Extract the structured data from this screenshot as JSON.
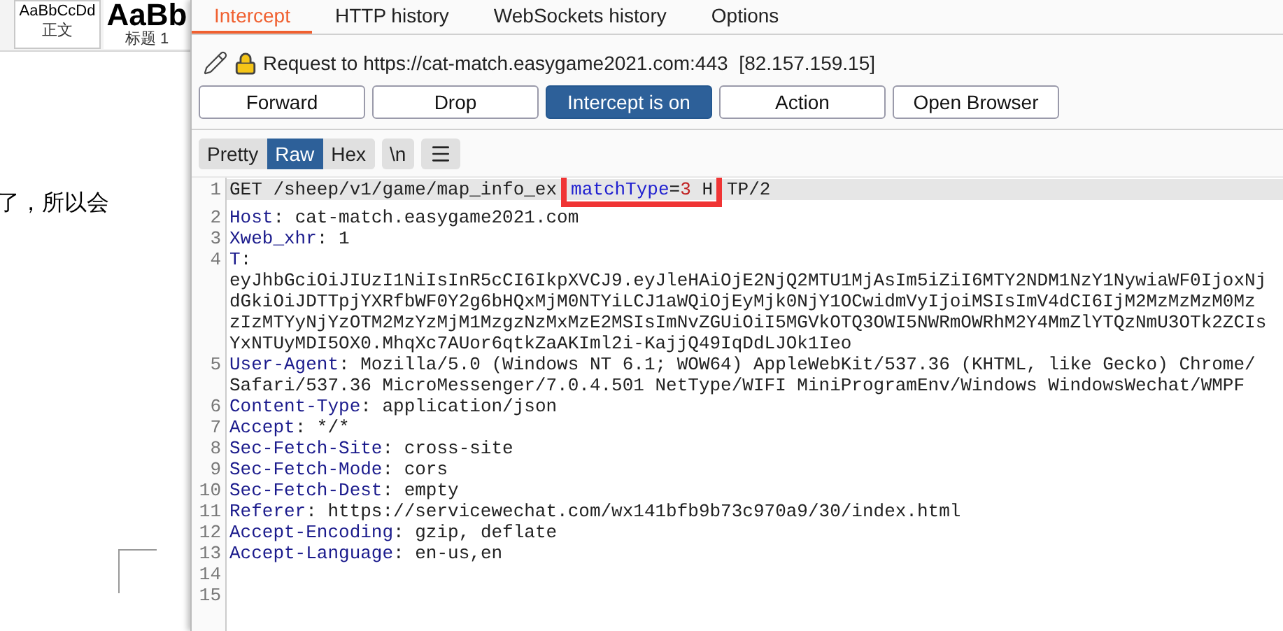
{
  "document": {
    "styles": [
      {
        "sample": "AaBbCcDd",
        "name": "正文",
        "selected": true
      },
      {
        "sample": "AaBb",
        "name": "标题 1",
        "selected": false
      }
    ],
    "text": "了，所以会"
  },
  "burp": {
    "tabs": [
      {
        "label": "Intercept",
        "selected": true
      },
      {
        "label": "HTTP history",
        "selected": false
      },
      {
        "label": "WebSockets history",
        "selected": false
      },
      {
        "label": "Options",
        "selected": false
      }
    ],
    "request_label": "Request to https://cat-match.easygame2021.com:443",
    "ip": "[82.157.159.15]",
    "buttons": [
      {
        "label": "Forward",
        "selected": false
      },
      {
        "label": "Drop",
        "selected": false
      },
      {
        "label": "Intercept is on",
        "selected": true
      },
      {
        "label": "Action",
        "selected": false
      },
      {
        "label": "Open Browser",
        "selected": false
      }
    ],
    "view_modes": [
      {
        "label": "Pretty",
        "selected": false
      },
      {
        "label": "Raw",
        "selected": true
      },
      {
        "label": "Hex",
        "selected": false
      }
    ],
    "newline_toggle": "\\n",
    "lines": [
      {
        "number": "1",
        "highlighted": true,
        "rows": [
          [
            {
              "kind": "plain",
              "text": "GET /sheep/v1/game/map_info_ex"
            },
            {
              "kind": "gap"
            },
            {
              "kind": "param",
              "text": "matchType"
            },
            {
              "kind": "plain",
              "text": "="
            },
            {
              "kind": "value",
              "text": "3"
            },
            {
              "kind": "plain",
              "text": " H"
            },
            {
              "kind": "gap"
            },
            {
              "kind": "plain",
              "text": "TP/2"
            }
          ]
        ]
      },
      {
        "number": "2",
        "highlighted": false,
        "rows": [
          [
            {
              "kind": "key",
              "text": "Host"
            },
            {
              "kind": "plain",
              "text": ": cat-match.easygame2021.com"
            }
          ]
        ]
      },
      {
        "number": "3",
        "highlighted": false,
        "rows": [
          [
            {
              "kind": "key",
              "text": "Xweb_xhr"
            },
            {
              "kind": "plain",
              "text": ": 1"
            }
          ]
        ]
      },
      {
        "number": "4",
        "highlighted": false,
        "rows": [
          [
            {
              "kind": "key",
              "text": "T"
            },
            {
              "kind": "plain",
              "text": ":"
            }
          ],
          [
            {
              "kind": "plain",
              "text": "eyJhbGciOiJIUzI1NiIsInR5cCI6IkpXVCJ9.eyJleHAiOjE2NjQ2MTU1MjAsIm5iZiI6MTY2NDM1NzY1NywiaWF0IjoxNj"
            }
          ],
          [
            {
              "kind": "plain",
              "text": "dGkiOiJDTTpjYXRfbWF0Y2g6bHQxMjM0NTYiLCJ1aWQiOjEyMjk0NjY1OCwidmVyIjoiMSIsImV4dCI6IjM2MzMzMzM0Mz"
            }
          ],
          [
            {
              "kind": "plain",
              "text": "zIzMTYyNjYzOTM2MzYzMjM1MzgzNzMxMzE2MSIsImNvZGUiOiI5MGVkOTQ3OWI5NWRmOWRhM2Y4MmZlYTQzNmU3OTk2ZCIs"
            }
          ],
          [
            {
              "kind": "plain",
              "text": "YxNTUyMDI5OX0.MhqXc7AUor6qtkZaAKIml2i-KajjQ49IqDdLJOk1Ieo"
            }
          ]
        ]
      },
      {
        "number": "5",
        "highlighted": false,
        "rows": [
          [
            {
              "kind": "key",
              "text": "User-Agent"
            },
            {
              "kind": "plain",
              "text": ": Mozilla/5.0 (Windows NT 6.1; WOW64) AppleWebKit/537.36 (KHTML, like Gecko) Chrome/"
            }
          ],
          [
            {
              "kind": "plain",
              "text": "Safari/537.36 MicroMessenger/7.0.4.501 NetType/WIFI MiniProgramEnv/Windows WindowsWechat/WMPF"
            }
          ]
        ]
      },
      {
        "number": "6",
        "highlighted": false,
        "rows": [
          [
            {
              "kind": "key",
              "text": "Content-Type"
            },
            {
              "kind": "plain",
              "text": ": application/json"
            }
          ]
        ]
      },
      {
        "number": "7",
        "highlighted": false,
        "rows": [
          [
            {
              "kind": "key",
              "text": "Accept"
            },
            {
              "kind": "plain",
              "text": ": */*"
            }
          ]
        ]
      },
      {
        "number": "8",
        "highlighted": false,
        "rows": [
          [
            {
              "kind": "key",
              "text": "Sec-Fetch-Site"
            },
            {
              "kind": "plain",
              "text": ": cross-site"
            }
          ]
        ]
      },
      {
        "number": "9",
        "highlighted": false,
        "rows": [
          [
            {
              "kind": "key",
              "text": "Sec-Fetch-Mode"
            },
            {
              "kind": "plain",
              "text": ": cors"
            }
          ]
        ]
      },
      {
        "number": "10",
        "highlighted": false,
        "rows": [
          [
            {
              "kind": "key",
              "text": "Sec-Fetch-Dest"
            },
            {
              "kind": "plain",
              "text": ": empty"
            }
          ]
        ]
      },
      {
        "number": "11",
        "highlighted": false,
        "rows": [
          [
            {
              "kind": "key",
              "text": "Referer"
            },
            {
              "kind": "plain",
              "text": ": https://servicewechat.com/wx141bfb9b73c970a9/30/index.html"
            }
          ]
        ]
      },
      {
        "number": "12",
        "highlighted": false,
        "rows": [
          [
            {
              "kind": "key",
              "text": "Accept-Encoding"
            },
            {
              "kind": "plain",
              "text": ": gzip, deflate"
            }
          ]
        ]
      },
      {
        "number": "13",
        "highlighted": false,
        "rows": [
          [
            {
              "kind": "key",
              "text": "Accept-Language"
            },
            {
              "kind": "plain",
              "text": ": en-us,en"
            }
          ]
        ]
      },
      {
        "number": "14",
        "highlighted": false,
        "rows": [
          []
        ]
      },
      {
        "number": "15",
        "highlighted": false,
        "rows": [
          []
        ]
      }
    ]
  }
}
